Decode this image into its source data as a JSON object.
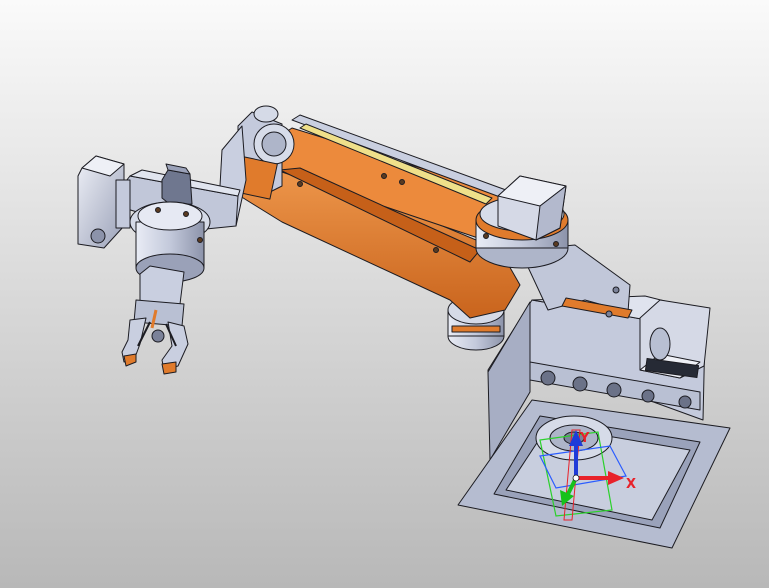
{
  "viewport": {
    "background_top": "#fafafa",
    "background_bottom": "#b8b8b8"
  },
  "colors": {
    "link_orange": "#e07b2c",
    "link_orange_dark": "#a94f12",
    "metal": "#c9cfe0",
    "metal_dark": "#8f96ad",
    "metal_light": "#e6e9f3",
    "base_plate": "#b5bcd0",
    "slot_yellow": "#efe08a",
    "edge": "#1c1c22"
  },
  "triad": {
    "x_label": "X",
    "y_label": "Y",
    "x_color": "#e8222a",
    "y_color": "#16c21b",
    "z_color": "#1f3bd8",
    "plane_blue": "#2a5cff",
    "plane_green": "#2bd12b",
    "plane_red": "#e8222a"
  },
  "icons": {
    "gripper": "gripper-icon",
    "wrist_motor": "motor-icon",
    "shoulder_motor": "motor-icon",
    "base_motor": "motor-icon",
    "triad": "coordinate-triad-icon"
  }
}
